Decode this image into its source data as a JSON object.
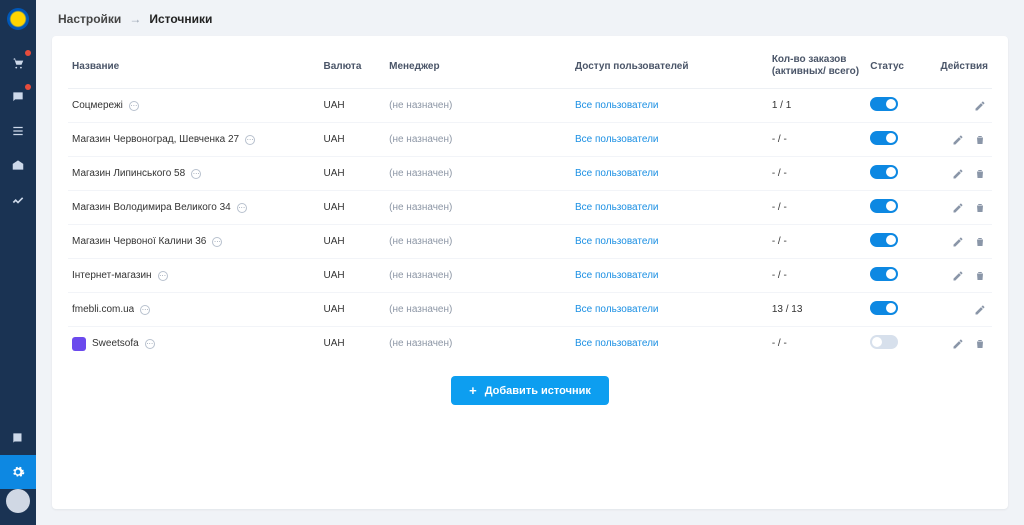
{
  "breadcrumb": {
    "parent": "Настройки",
    "current": "Источники"
  },
  "headers": {
    "name": "Название",
    "currency": "Валюта",
    "manager": "Менеджер",
    "access": "Доступ пользователей",
    "orders": "Кол-во заказов (активных/ всего)",
    "status": "Статус",
    "actions": "Действия"
  },
  "not_assigned": "(не назначен)",
  "all_users": "Все пользователи",
  "add_button": "Добавить источник",
  "rows": [
    {
      "name": "Соцмережі",
      "currency": "UAH",
      "orders": "1 / 1",
      "status_on": true,
      "has_icon": false,
      "can_delete": false
    },
    {
      "name": "Магазин Червоноград, Шевченка 27",
      "currency": "UAH",
      "orders": "- / -",
      "status_on": true,
      "has_icon": false,
      "can_delete": true
    },
    {
      "name": "Магазин Липинського 58",
      "currency": "UAH",
      "orders": "- / -",
      "status_on": true,
      "has_icon": false,
      "can_delete": true
    },
    {
      "name": "Магазин Володимира Великого 34",
      "currency": "UAH",
      "orders": "- / -",
      "status_on": true,
      "has_icon": false,
      "can_delete": true
    },
    {
      "name": "Магазин Червоної Калини 36",
      "currency": "UAH",
      "orders": "- / -",
      "status_on": true,
      "has_icon": false,
      "can_delete": true
    },
    {
      "name": "Інтернет-магазин",
      "currency": "UAH",
      "orders": "- / -",
      "status_on": true,
      "has_icon": false,
      "can_delete": true
    },
    {
      "name": "fmebli.com.ua",
      "currency": "UAH",
      "orders": "13 / 13",
      "status_on": true,
      "has_icon": false,
      "can_delete": false
    },
    {
      "name": "Sweetsofa",
      "currency": "UAH",
      "orders": "- / -",
      "status_on": false,
      "has_icon": true,
      "can_delete": true
    }
  ],
  "colors": {
    "accent": "#0d9ef0",
    "sidebar": "#1a3353"
  }
}
